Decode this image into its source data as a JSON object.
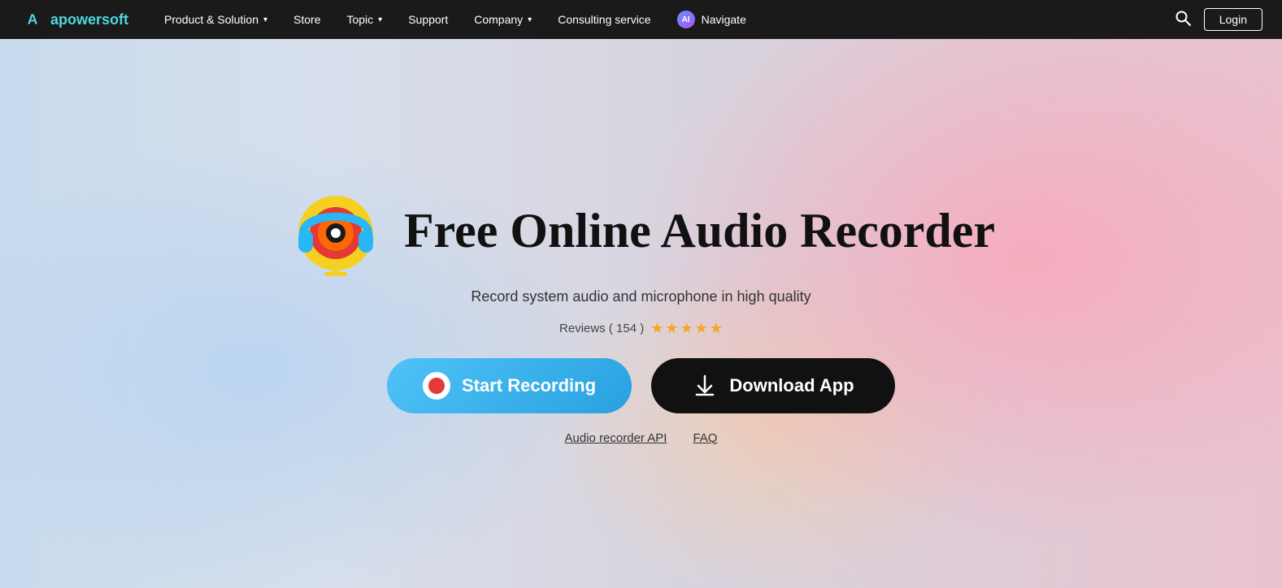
{
  "nav": {
    "logo_text": "apowersoft",
    "items": [
      {
        "label": "Product & Solution",
        "has_dropdown": true
      },
      {
        "label": "Store",
        "has_dropdown": false
      },
      {
        "label": "Topic",
        "has_dropdown": true
      },
      {
        "label": "Support",
        "has_dropdown": false
      },
      {
        "label": "Company",
        "has_dropdown": true
      },
      {
        "label": "Consulting service",
        "has_dropdown": false
      },
      {
        "label": "Navigate",
        "has_ai": true,
        "has_dropdown": false
      }
    ],
    "login_label": "Login"
  },
  "hero": {
    "title": "Free Online Audio Recorder",
    "subtitle": "Record system audio and microphone in high quality",
    "reviews_label": "Reviews ( 154 )",
    "star_count": 5,
    "btn_start_label": "Start Recording",
    "btn_download_label": "Download App",
    "link_api": "Audio recorder API",
    "link_faq": "FAQ"
  }
}
